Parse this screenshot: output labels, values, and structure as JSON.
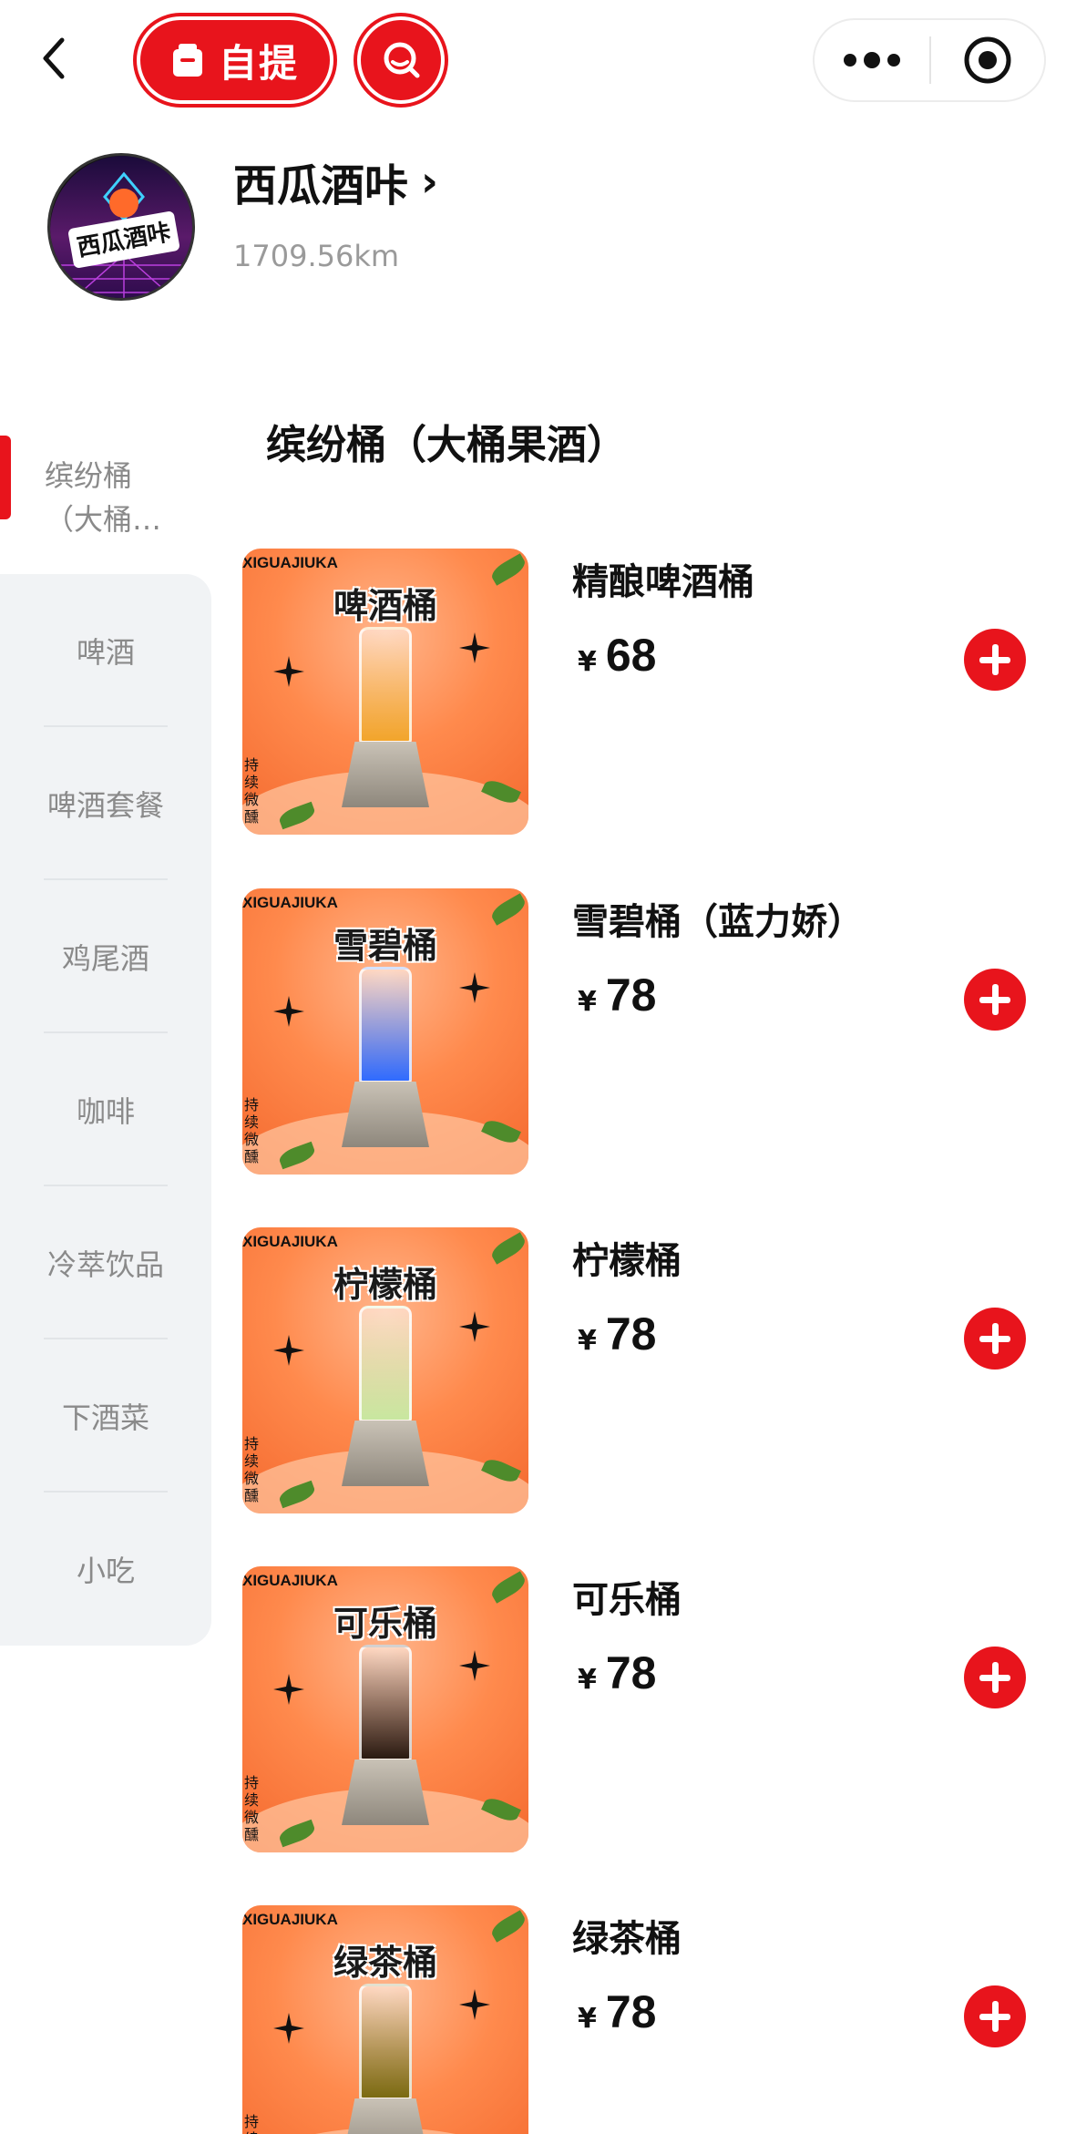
{
  "topbar": {
    "pickup_label": "自提",
    "icons": {
      "back": "back-chevron-icon",
      "bag": "bag-icon",
      "search": "search-icon",
      "more": "more-dots-icon",
      "target": "target-icon"
    }
  },
  "shop": {
    "name": "西瓜酒咔",
    "chevron": "›",
    "distance": "1709.56km",
    "logo_text": "西瓜酒咔"
  },
  "sidebar": {
    "active": "缤纷桶（大桶果酒）",
    "items": [
      "啤酒",
      "啤酒套餐",
      "鸡尾酒",
      "咖啡",
      "冷萃饮品",
      "下酒菜",
      "小吃"
    ]
  },
  "category": {
    "title": "缤纷桶（大桶果酒）"
  },
  "thumb_common": {
    "brand": "XIGUAJIUKA",
    "slogan": "持续微醺"
  },
  "products": [
    {
      "name": "精酿啤酒桶",
      "currency": "¥",
      "price": "68",
      "thumb_title": "啤酒桶",
      "liquid": "#f2a52c"
    },
    {
      "name": "雪碧桶（蓝力娇）",
      "currency": "¥",
      "price": "78",
      "thumb_title": "雪碧桶",
      "liquid": "#2f6bff"
    },
    {
      "name": "柠檬桶",
      "currency": "¥",
      "price": "78",
      "thumb_title": "柠檬桶",
      "liquid": "#c8e7a0"
    },
    {
      "name": "可乐桶",
      "currency": "¥",
      "price": "78",
      "thumb_title": "可乐桶",
      "liquid": "#2a1a12"
    },
    {
      "name": "绿茶桶",
      "currency": "¥",
      "price": "78",
      "thumb_title": "绿茶桶",
      "liquid": "#7a6a12"
    }
  ],
  "colors": {
    "accent": "#e8141c",
    "sidebar_bg": "#f1f3f5",
    "muted_text": "#8a8a8a"
  }
}
